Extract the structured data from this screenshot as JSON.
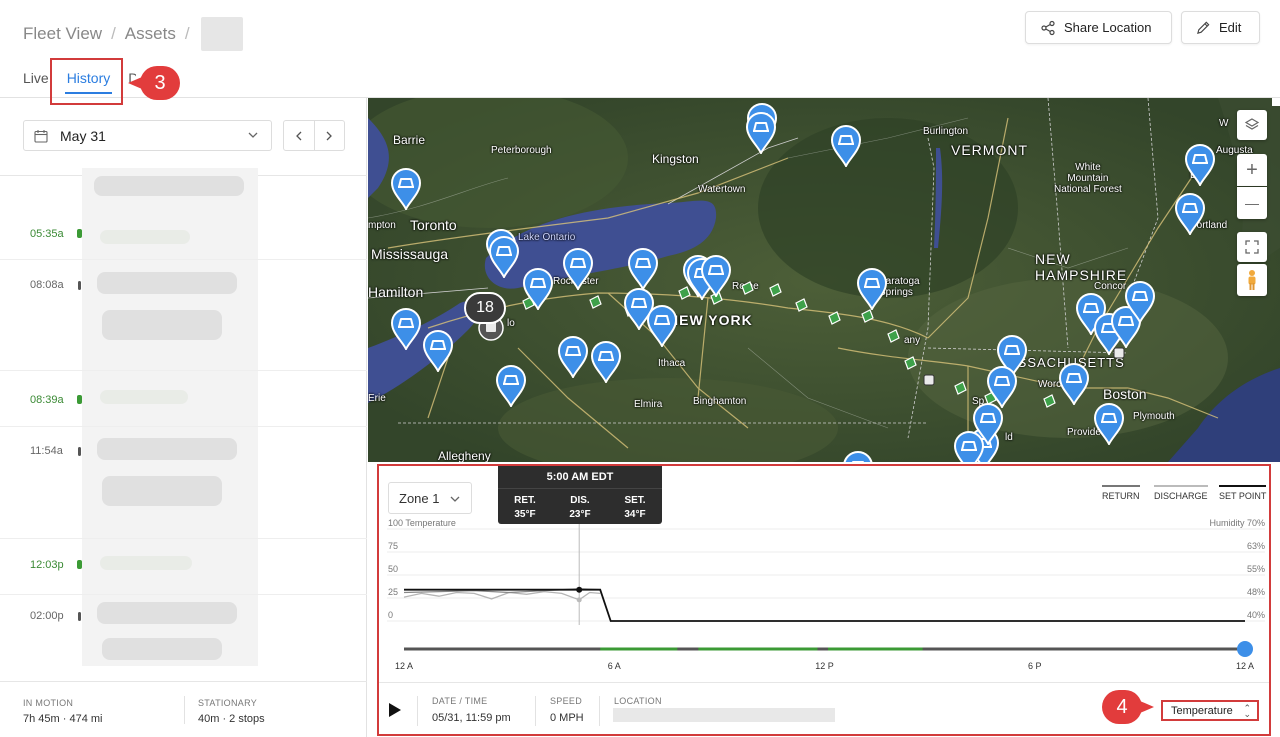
{
  "header": {
    "breadcrumb": [
      "Fleet View",
      "Assets"
    ],
    "separator": "/",
    "tabs": [
      {
        "label": "Live",
        "active": false
      },
      {
        "label": "History",
        "active": true
      },
      {
        "label": "D",
        "active": false
      }
    ],
    "share_label": "Share Location",
    "edit_label": "Edit"
  },
  "callouts": {
    "first": "3",
    "second": "4"
  },
  "left_panel": {
    "date": "May 31",
    "prev_icon": "chevron-left-icon",
    "next_icon": "chevron-right-icon",
    "timeline": [
      {
        "time": "05:35a",
        "status": "motion"
      },
      {
        "time": "08:08a",
        "status": "stop"
      },
      {
        "time": "08:39a",
        "status": "motion"
      },
      {
        "time": "11:54a",
        "status": "stop"
      },
      {
        "time": "12:03p",
        "status": "motion"
      },
      {
        "time": "02:00p",
        "status": "stop"
      }
    ],
    "stats": {
      "in_motion_label": "IN MOTION",
      "in_motion_value": "7h 45m · 474 mi",
      "stationary_label": "STATIONARY",
      "stationary_value": "40m · 2 stops"
    }
  },
  "map": {
    "labels": {
      "barrie": "Barrie",
      "peterborough": "Peterborough",
      "kingston": "Kingston",
      "watertown": "Watertown",
      "toronto": "Toronto",
      "mpton": "mpton",
      "mississauga": "Mississauga",
      "hamilton": "Hamilton",
      "lake_ontario": "Lake Ontario",
      "rochester": "Rochester",
      "ester": "ester",
      "new_york": "NEW YORK",
      "ithaca": "Ithaca",
      "elmira": "Elmira",
      "binghamton": "Binghamton",
      "allegheny": "Allegheny",
      "erie": "Erie",
      "burlington": "Burlington",
      "vermont": "VERMONT",
      "saratoga": "Saratoga\nSprings",
      "any": "any",
      "white_mtn": "White\nMountain\nNational Forest",
      "new_hampshire": "NEW\nHAMPSHIRE",
      "augusta": "Augusta",
      "portland": "Portland",
      "massachusetts": "ASSACHUSETTS",
      "boston": "Boston",
      "worcester": "Worces",
      "plymouth": "Plymouth",
      "providence": "Providen",
      "concord": "Concor",
      "rome": "Rome",
      "lo": "lo",
      "ld": "ld",
      "sp": "Sp",
      "w": "W",
      "le": "Le"
    },
    "cluster_count": "18",
    "layers_icon": "layers-icon",
    "zoom_in": "+",
    "zoom_out": "—"
  },
  "chart_panel": {
    "zone": "Zone 1",
    "tooltip": {
      "time": "5:00 AM EDT",
      "ret_label": "RET.",
      "ret_value": "35°F",
      "dis_label": "DIS.",
      "dis_value": "23°F",
      "set_label": "SET.",
      "set_value": "34°F"
    },
    "legend": [
      "RETURN",
      "DISCHARGE",
      "SET POINT"
    ],
    "time_labels": [
      "12 A",
      "6 A",
      "12 P",
      "6 P",
      "12 A"
    ],
    "footer": {
      "datetime_label": "DATE / TIME",
      "datetime_value": "05/31, 11:59 pm",
      "speed_label": "SPEED",
      "speed_value": "0 MPH",
      "location_label": "LOCATION"
    },
    "metric": "Temperature"
  },
  "chart_data": {
    "type": "line",
    "title": "",
    "xlabel": "",
    "ylabel": "Temperature",
    "ylabel_right": "Humidity",
    "ylim": [
      0,
      100
    ],
    "yticks": [
      0,
      25,
      50,
      75,
      100
    ],
    "yticks_right": [
      "40%",
      "48%",
      "55%",
      "63%",
      "70%"
    ],
    "xlim": [
      0,
      24
    ],
    "xticks": [
      "12 A",
      "6 A",
      "12 P",
      "6 P",
      "12 A"
    ],
    "series": [
      {
        "name": "DISCHARGE",
        "x": [
          0,
          0.5,
          1,
          1.5,
          2,
          2.5,
          3,
          3.5,
          4,
          4.5,
          5,
          5.3,
          5.6
        ],
        "y": [
          26,
          30,
          27,
          31,
          30,
          24,
          31,
          29,
          32,
          30,
          23,
          31,
          30
        ]
      },
      {
        "name": "RETURN",
        "x": [
          0,
          1,
          2,
          3,
          4,
          5,
          5.6
        ],
        "y": [
          31,
          32,
          33,
          31,
          33,
          35,
          34
        ]
      },
      {
        "name": "SET POINT",
        "x": [
          0,
          5.6,
          5.9,
          24
        ],
        "y": [
          34,
          34,
          0,
          0
        ]
      }
    ],
    "cursor_x": 5,
    "playhead_x": 24,
    "motion_segments": [
      [
        5.6,
        7.8
      ],
      [
        8.4,
        11.8
      ],
      [
        12.1,
        14.8
      ]
    ]
  },
  "colors": {
    "accent": "#2b7de0",
    "highlight": "#d23b3b",
    "pin": "#3d8fe8",
    "motion": "#3b9a35"
  }
}
